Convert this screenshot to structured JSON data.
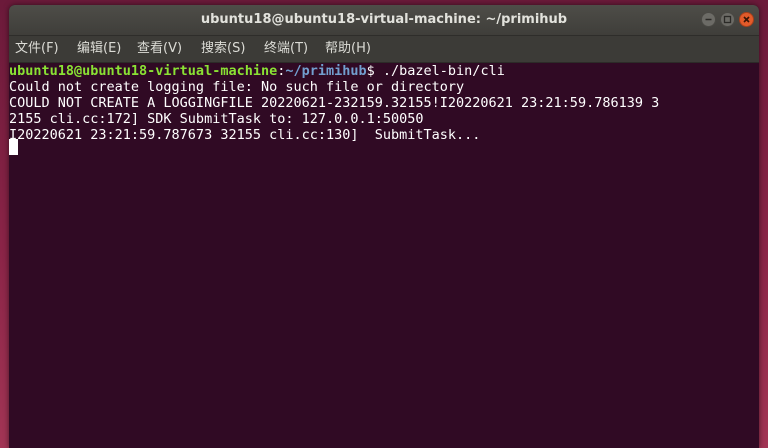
{
  "window": {
    "title": "ubuntu18@ubuntu18-virtual-machine: ~/primihub"
  },
  "menu": {
    "items": [
      "文件(F)",
      "编辑(E)",
      "查看(V)",
      "搜索(S)",
      "终端(T)",
      "帮助(H)"
    ]
  },
  "terminal": {
    "prompt_user": "ubuntu18@ubuntu18-virtual-machine",
    "prompt_sep": ":",
    "prompt_path": "~/primihub",
    "prompt_symbol": "$ ",
    "command": "./bazel-bin/cli",
    "output": [
      "Could not create logging file: No such file or directory",
      "COULD NOT CREATE A LOGGINGFILE 20220621-232159.32155!I20220621 23:21:59.786139 3",
      "2155 cli.cc:172] SDK SubmitTask to: 127.0.0.1:50050",
      "I20220621 23:21:59.787673 32155 cli.cc:130]  SubmitTask..."
    ]
  },
  "colors": {
    "terminal_bg": "#300a24",
    "prompt_user": "#8ae234",
    "prompt_path": "#729fcf",
    "close_button": "#e35b2a"
  },
  "icons": [
    "minimize-icon",
    "maximize-icon",
    "close-icon"
  ]
}
